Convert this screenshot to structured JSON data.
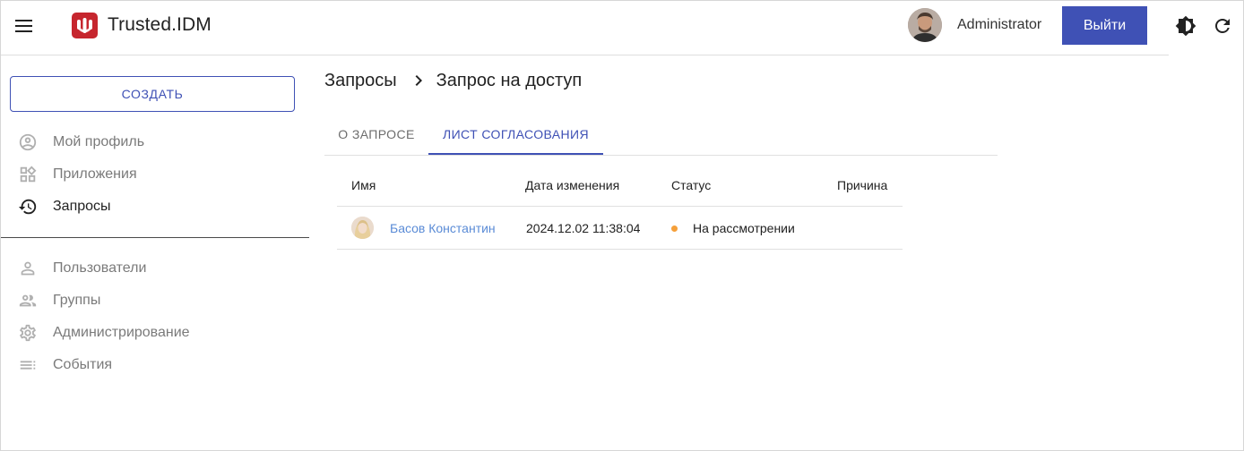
{
  "header": {
    "app_title": "Trusted.IDM",
    "user_name": "Administrator",
    "logout_label": "Выйти",
    "brand_color": "#c6262e",
    "accent_color": "#3f51b5"
  },
  "sidebar": {
    "create_label": "СОЗДАТЬ",
    "items": [
      {
        "label": "Мой профиль",
        "icon": "account-circle-icon"
      },
      {
        "label": "Приложения",
        "icon": "widgets-icon"
      },
      {
        "label": "Запросы",
        "icon": "history-icon",
        "active": true
      },
      {
        "label": "Пользователи",
        "icon": "person-icon"
      },
      {
        "label": "Группы",
        "icon": "people-icon"
      },
      {
        "label": "Администрирование",
        "icon": "gear-icon"
      },
      {
        "label": "События",
        "icon": "list-icon"
      }
    ]
  },
  "breadcrumb": {
    "parent": "Запросы",
    "current": "Запрос на доступ"
  },
  "tabs": [
    {
      "label": "О ЗАПРОСЕ",
      "active": false
    },
    {
      "label": "ЛИСТ СОГЛАСОВАНИЯ",
      "active": true
    }
  ],
  "table": {
    "columns": [
      "Имя",
      "Дата изменения",
      "Статус",
      "Причина"
    ],
    "rows": [
      {
        "name": "Басов Константин",
        "changed": "2024.12.02 11:38:04",
        "status": "На рассмотрении",
        "status_color": "#f5a03a",
        "reason": ""
      }
    ]
  }
}
